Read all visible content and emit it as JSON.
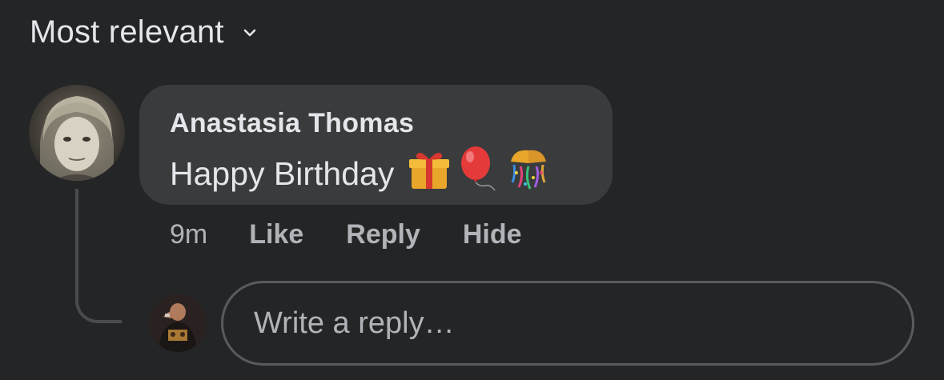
{
  "sort": {
    "label": "Most relevant",
    "icon": "chevron-down-icon"
  },
  "comment": {
    "author": "Anastasia Thomas",
    "text": "Happy Birthday",
    "emojis": [
      "gift-icon",
      "balloon-icon",
      "confetti-ball-icon"
    ],
    "avatar": "user-avatar-photo",
    "time": "9m",
    "actions": {
      "like": "Like",
      "reply": "Reply",
      "hide": "Hide"
    }
  },
  "reply": {
    "placeholder": "Write a reply…",
    "avatar": "current-user-avatar-photo"
  },
  "colors": {
    "background": "#242526",
    "bubble": "#3a3b3c",
    "primary_text": "#e4e6eb",
    "secondary_text": "#b0b3b8",
    "input_border": "#5a5b5e",
    "thread_line": "#4a4b4d"
  }
}
